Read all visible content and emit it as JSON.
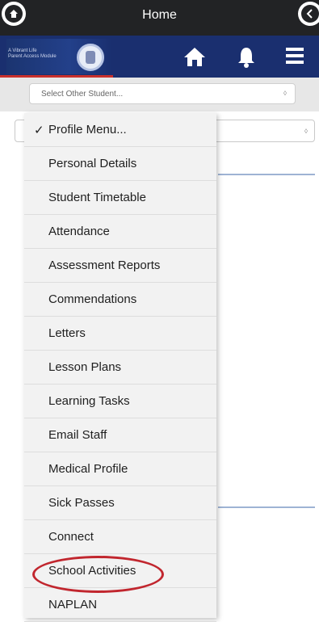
{
  "topbar": {
    "title": "Home"
  },
  "brand": {
    "line1": "A Vibrant Life",
    "line2": "Parent Access Module"
  },
  "student_select": {
    "placeholder": "Select Other Student..."
  },
  "menu": {
    "selected": "Profile Menu...",
    "items": [
      "Personal Details",
      "Student Timetable",
      "Attendance",
      "Assessment Reports",
      "Commendations",
      "Letters",
      "Lesson Plans",
      "Learning Tasks",
      "Email Staff",
      "Medical Profile",
      "Sick Passes",
      "Connect",
      "School Activities",
      "NAPLAN"
    ]
  },
  "colors": {
    "topbar": "#222325",
    "brandbar": "#1a2f6f",
    "highlight": "#c1262e"
  },
  "icons": [
    "home-nav-icon",
    "back-icon",
    "close-icon",
    "home-icon",
    "bell-icon",
    "menu-icon"
  ]
}
